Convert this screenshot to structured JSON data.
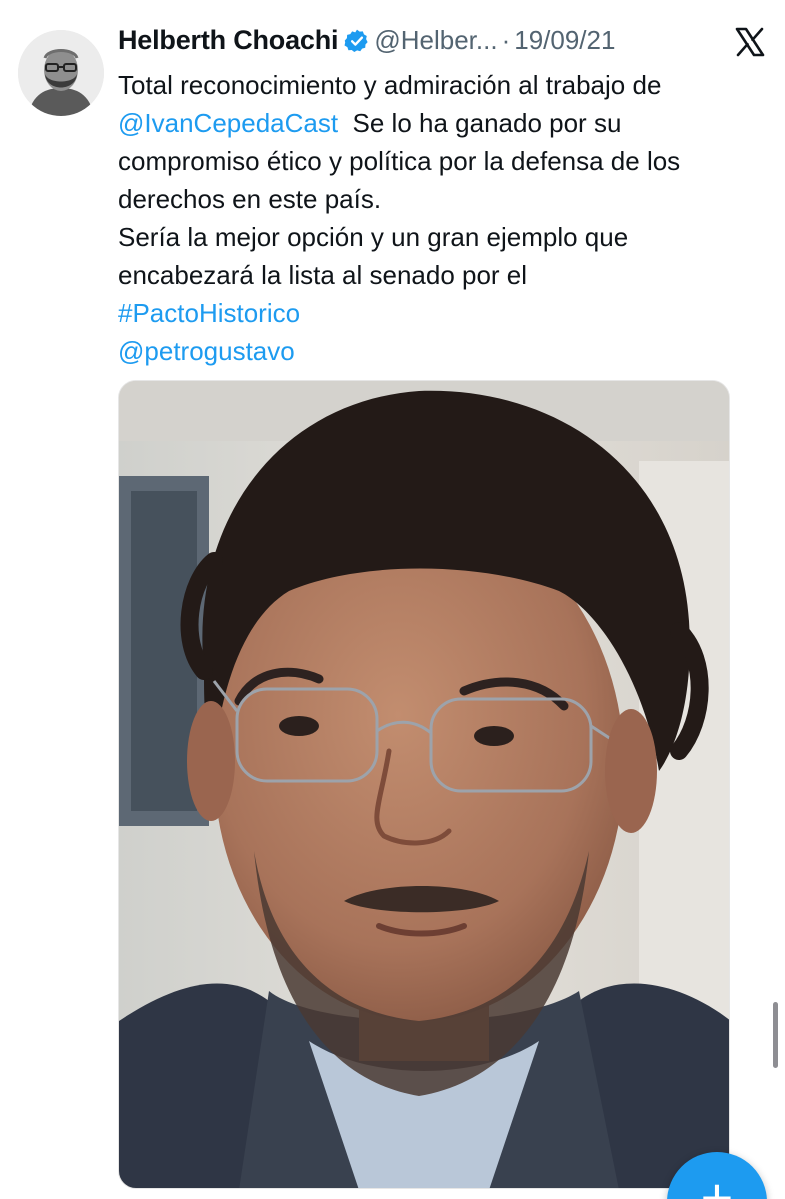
{
  "tweet": {
    "author_name": "Helberth Choachi",
    "handle": "@Helber...",
    "separator": "·",
    "date": "19/09/21",
    "lines": [
      {
        "text": "Total reconocimiento y admiración al trabajo de",
        "type": "text"
      },
      {
        "mention": "@IvanCepedaCast",
        "rest": "  Se lo ha ganado por su",
        "type": "mention-line"
      },
      {
        "text": "compromiso ético y política por la defensa de los",
        "type": "text"
      },
      {
        "text": "derechos en este país.",
        "type": "text"
      },
      {
        "text": "Sería la mejor opción y un gran ejemplo que",
        "type": "text"
      },
      {
        "text": "encabezará la lista al senado por el",
        "type": "text"
      },
      {
        "text": "#PactoHistorico",
        "type": "link"
      },
      {
        "text": "@petrogustavo",
        "type": "link"
      }
    ]
  },
  "icons": {
    "verified": "verified-badge-icon",
    "platform": "x-logo-icon",
    "compose": "plus-icon"
  },
  "fab": {
    "label": "+"
  },
  "colors": {
    "link": "#1d9bf0",
    "text": "#0f1419",
    "secondary": "#536471",
    "fab": "#1d9bf0"
  }
}
